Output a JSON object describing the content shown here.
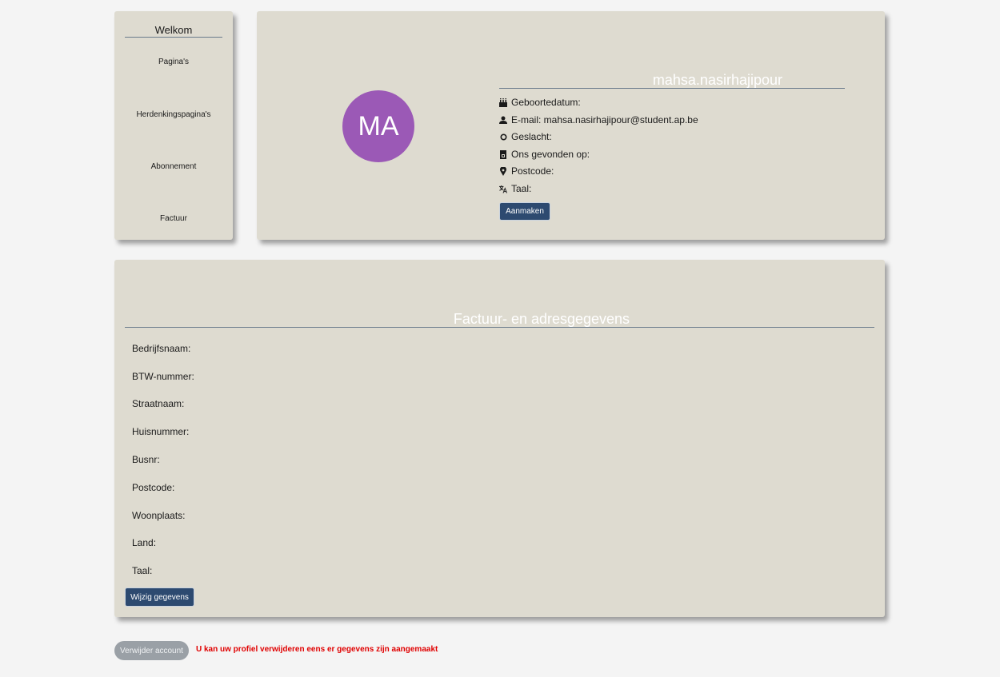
{
  "sidebar": {
    "title": "Welkom",
    "items": [
      {
        "label": "Pagina's"
      },
      {
        "label": "Herdenkingspagina's"
      },
      {
        "label": "Abonnement"
      },
      {
        "label": "Factuur"
      }
    ]
  },
  "profile": {
    "avatar_initials": "MA",
    "avatar_color": "#9b59b6",
    "username": "mahsa.nasirhajipour",
    "fields": [
      {
        "icon": "cake-icon",
        "label": "Geboortedatum:"
      },
      {
        "icon": "user-icon",
        "label": "E-mail: mahsa.nasirhajipour@student.ap.be"
      },
      {
        "icon": "circle-icon",
        "label": "Geslacht:"
      },
      {
        "icon": "document-icon",
        "label": "Ons gevonden op:"
      },
      {
        "icon": "location-pin-icon",
        "label": "Postcode:"
      },
      {
        "icon": "translate-icon",
        "label": "Taal:"
      }
    ],
    "create_button": "Aanmaken"
  },
  "billing": {
    "title": "Factuur- en adresgegevens",
    "fields": [
      "Bedrijfsnaam:",
      "BTW-nummer:",
      "Straatnaam:",
      "Huisnummer:",
      "Busnr:",
      "Postcode:",
      "Woonplaats:",
      "Land:",
      "Taal:"
    ],
    "edit_button": "Wijzig gegevens"
  },
  "footer": {
    "delete_button": "Verwijder account",
    "delete_note": "U kan uw profiel verwijderen eens er gegevens zijn aangemaakt"
  },
  "colors": {
    "card_bg": "#dedbd0",
    "button_primary": "#2d4a70",
    "warning_text": "#e00000"
  }
}
